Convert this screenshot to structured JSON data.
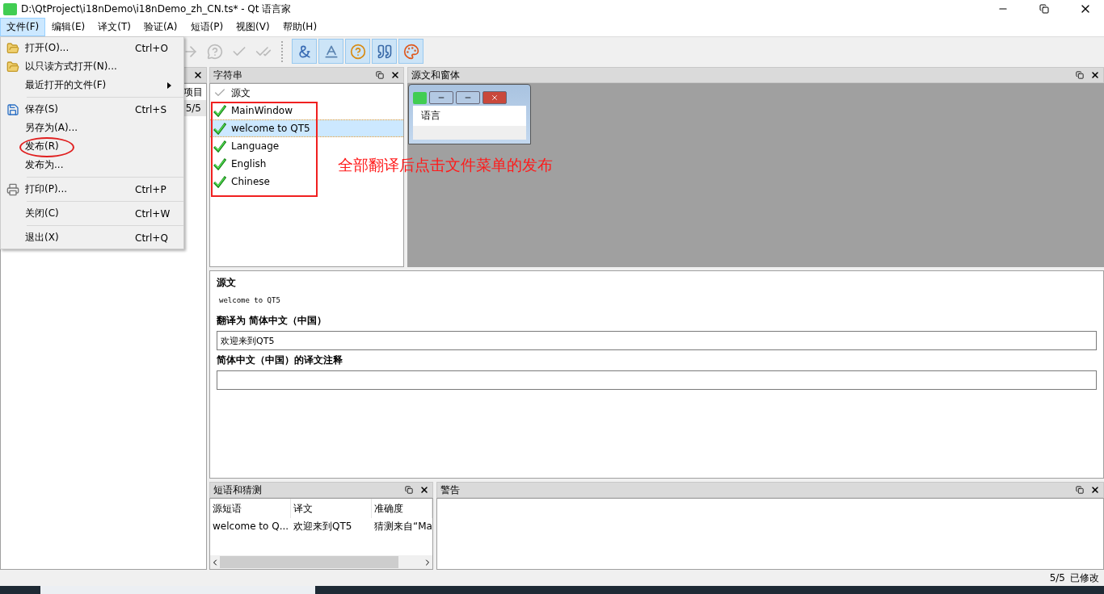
{
  "window": {
    "title": "D:\\QtProject\\i18nDemo\\i18nDemo_zh_CN.ts* - Qt 语言家"
  },
  "menu_bar": [
    {
      "label": "文件(F)",
      "selected": true
    },
    {
      "label": "编辑(E)",
      "selected": false
    },
    {
      "label": "译文(T)",
      "selected": false
    },
    {
      "label": "验证(A)",
      "selected": false
    },
    {
      "label": "短语(P)",
      "selected": false
    },
    {
      "label": "视图(V)",
      "selected": false
    },
    {
      "label": "帮助(H)",
      "selected": false
    }
  ],
  "file_menu": [
    {
      "kind": "item",
      "label": "打开(O)...",
      "shortcut": "Ctrl+O",
      "circled": false
    },
    {
      "kind": "item",
      "label": "以只读方式打开(N)...",
      "circled": false
    },
    {
      "kind": "submenu",
      "label": "最近打开的文件(F)",
      "circled": false
    },
    {
      "kind": "separator"
    },
    {
      "kind": "item",
      "label": "保存(S)",
      "shortcut": "Ctrl+S",
      "circled": false
    },
    {
      "kind": "item",
      "label": "另存为(A)...",
      "circled": false
    },
    {
      "kind": "item",
      "label": "发布(R)",
      "circled": true
    },
    {
      "kind": "item",
      "label": "发布为...",
      "circled": false
    },
    {
      "kind": "separator"
    },
    {
      "kind": "item",
      "label": "打印(P)...",
      "shortcut": "Ctrl+P",
      "circled": false
    },
    {
      "kind": "separator"
    },
    {
      "kind": "item",
      "label": "关闭(C)",
      "shortcut": "Ctrl+W",
      "circled": false
    },
    {
      "kind": "separator"
    },
    {
      "kind": "item",
      "label": "退出(X)",
      "shortcut": "Ctrl+Q",
      "circled": false
    }
  ],
  "toolbar": {
    "validation_toggles": [
      {
        "on": true
      },
      {
        "on": true
      },
      {
        "on": true
      },
      {
        "on": true
      },
      {
        "on": true
      }
    ]
  },
  "context_dock": {
    "column_header": "项目",
    "rows": [
      {
        "cell": "5/5",
        "selected": true
      }
    ]
  },
  "strings_dock": {
    "title": "字符串",
    "column_header": "源文",
    "boxed": true,
    "rows": [
      {
        "text": "MainWindow",
        "done": true,
        "selected": false
      },
      {
        "text": "welcome to QT5",
        "done": true,
        "selected": true
      },
      {
        "text": "Language",
        "done": true,
        "selected": false
      },
      {
        "text": "English",
        "done": true,
        "selected": false
      },
      {
        "text": "Chinese",
        "done": true,
        "selected": false
      }
    ]
  },
  "form_dock": {
    "title": "源文和窗体",
    "preview_label": "语言"
  },
  "editor": {
    "source_label": "源文",
    "source_text": "welcome to QT5",
    "translation_label": "翻译为 简体中文（中国）",
    "translation_value": "欢迎来到QT5",
    "comment_label": "简体中文（中国）的译文注释"
  },
  "phrases_dock": {
    "title": "短语和猜测",
    "columns": [
      "源短语",
      "译文",
      "准确度"
    ],
    "rows": [
      [
        "welcome to Q...",
        "欢迎来到QT5",
        "猜测来自“Ma"
      ]
    ]
  },
  "warnings_dock": {
    "title": "警告"
  },
  "status_bar": {
    "count": "5/5",
    "state": "已修改"
  },
  "annotation": {
    "note": "全部翻译后点击文件菜单的发布"
  }
}
